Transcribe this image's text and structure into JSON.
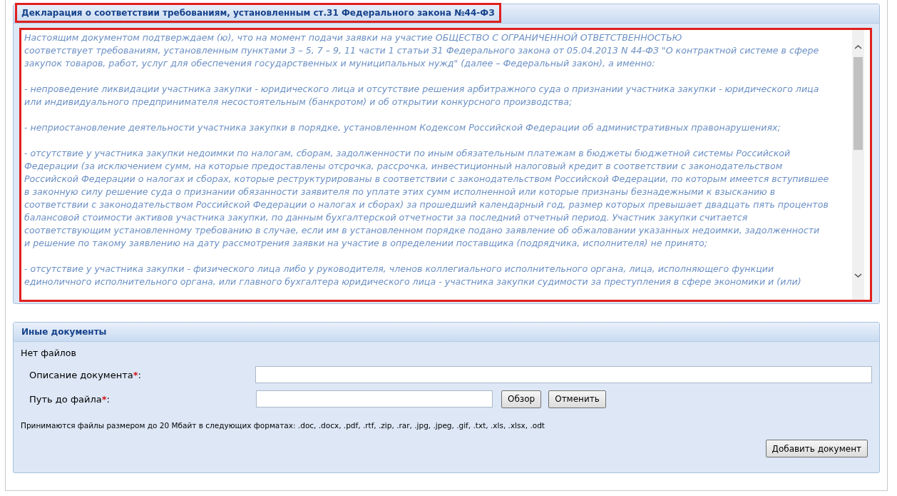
{
  "declaration": {
    "title": "Декларация о соответствии требованиям, установленным ст.31 Федерального закона №44-ФЗ",
    "highlighted": true,
    "paragraphs": [
      [
        "Настоящим документом подтверждаем (ю), что на момент подачи заявки на участие ОБЩЕСТВО С ОГРАНИЧЕННОЙ ОТВЕТСТВЕННОСТЬЮ",
        "соответствует требованиям, установленным пунктами 3 – 5, 7 – 9, 11 части 1 статьи 31 Федерального закона от 05.04.2013 N 44-ФЗ \"О контрактной системе в сфере",
        "закупок товаров, работ, услуг для обеспечения государственных и муниципальных нужд\" (далее – Федеральный закон), а именно:"
      ],
      [
        "- непроведение ликвидации участника закупки - юридического лица и отсутствие решения арбитражного суда о признании участника закупки - юридического лица",
        "или индивидуального предпринимателя несостоятельным (банкротом) и об открытии конкурсного производства;"
      ],
      [
        "- неприостановление деятельности участника закупки в порядке, установленном Кодексом Российской Федерации об административных правонарушениях;"
      ],
      [
        "- отсутствие у участника закупки недоимки по налогам, сборам, задолженности по иным обязательным платежам в бюджеты бюджетной системы Российской",
        "Федерации (за исключением сумм, на которые предоставлены отсрочка, рассрочка, инвестиционный налоговый кредит в соответствии с законодательством",
        "Российской Федерации о налогах и сборах, которые реструктурированы в соответствии с законодательством Российской Федерации, по которым имеется вступившее",
        "в законную силу решение суда о признании обязанности заявителя по уплате этих сумм исполненной или которые признаны безнадежными к взысканию в",
        "соответствии с законодательством Российской Федерации о налогах и сборах) за прошедший календарный год, размер которых превышает двадцать пять процентов",
        "балансовой стоимости активов участника закупки, по данным бухгалтерской отчетности за последний отчетный период. Участник закупки считается",
        "соответствующим установленному требованию в случае, если им в установленном порядке подано заявление об обжаловании указанных недоимки, задолженности",
        "и решение по такому заявлению на дату рассмотрения заявки на участие в определении поставщика (подрядчика, исполнителя) не принято;"
      ],
      [
        "- отсутствие у участника закупки - физического лица либо у руководителя, членов коллегиального исполнительного органа, лица, исполняющего функции",
        "единоличного исполнительного органа, или главного бухгалтера юридического лица - участника закупки судимости за преступления в сфере экономики и (или)"
      ]
    ]
  },
  "other_documents": {
    "title": "Иные документы",
    "files_note": "Нет файлов",
    "fields": [
      {
        "label": "Описание документа",
        "required_mark": "*",
        "suffix": ":",
        "kind": "wide"
      },
      {
        "label": "Путь до файла",
        "required_mark": "*",
        "suffix": ":",
        "kind": "file"
      }
    ],
    "file_buttons": [
      "Обзор",
      "Отменить"
    ],
    "formats_note": "Принимаются файлы размером до 20 Мбайт в следующих форматах: .doc, .docx, .pdf, .rtf, .zip, .rar, .jpg, .jpeg, .gif, .txt, .xls, .xlsx, .odt",
    "add_button": "Добавить документ"
  }
}
